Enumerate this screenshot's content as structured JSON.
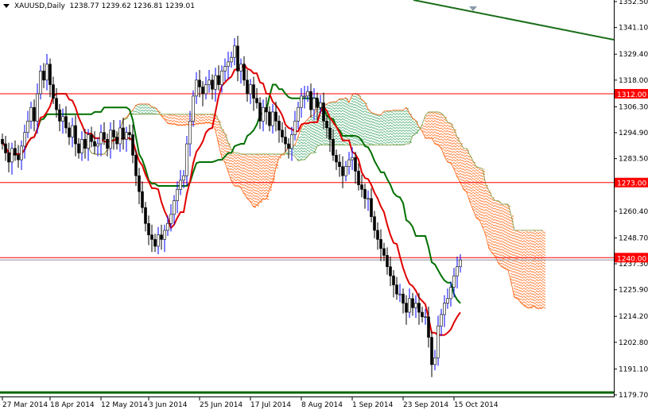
{
  "header": {
    "symbol": "XAUUSD,Daily",
    "ohlc": "1238.77 1239.62 1236.81 1239.01"
  },
  "chart_data": {
    "type": "candlestick",
    "title": "XAUUSD,Daily",
    "ylim": [
      1179.7,
      1352.5
    ],
    "y_ticks": [
      "1352.50",
      "1341.10",
      "1329.40",
      "1318.00",
      "1306.30",
      "1294.90",
      "1283.50",
      "1260.40",
      "1248.70",
      "1237.30",
      "1225.90",
      "1214.20",
      "1202.80",
      "1191.10",
      "1179.70"
    ],
    "x_ticks": [
      {
        "bar": 0,
        "label": "27 Mar 2014"
      },
      {
        "bar": 15,
        "label": "18 Apr 2014"
      },
      {
        "bar": 31,
        "label": "12 May 2014"
      },
      {
        "bar": 46,
        "label": "3 Jun 2014"
      },
      {
        "bar": 62,
        "label": "25 Jun 2014"
      },
      {
        "bar": 78,
        "label": "17 Jul 2014"
      },
      {
        "bar": 94,
        "label": "8 Aug 2014"
      },
      {
        "bar": 110,
        "label": "1 Sep 2014"
      },
      {
        "bar": 126,
        "label": "23 Sep 2014"
      },
      {
        "bar": 142,
        "label": "15 Oct 2014"
      }
    ],
    "closes": [
      1290,
      1286,
      1282,
      1288,
      1285,
      1283,
      1289,
      1295,
      1300,
      1306,
      1300,
      1312,
      1322,
      1318,
      1325,
      1316,
      1310,
      1305,
      1300,
      1302,
      1297,
      1293,
      1298,
      1290,
      1286,
      1292,
      1288,
      1294,
      1291,
      1289,
      1290,
      1295,
      1292,
      1288,
      1296,
      1293,
      1290,
      1297,
      1292,
      1295,
      1294,
      1285,
      1276,
      1269,
      1262,
      1255,
      1250,
      1248,
      1245,
      1250,
      1248,
      1252,
      1255,
      1259,
      1265,
      1270,
      1274,
      1276,
      1290,
      1300,
      1311,
      1318,
      1315,
      1312,
      1316,
      1318,
      1314,
      1320,
      1316,
      1322,
      1324,
      1326,
      1328,
      1333,
      1322,
      1325,
      1318,
      1312,
      1316,
      1310,
      1308,
      1300,
      1306,
      1304,
      1298,
      1304,
      1300,
      1296,
      1293,
      1290,
      1288,
      1294,
      1300,
      1306,
      1311,
      1311,
      1313,
      1305,
      1310,
      1306,
      1308,
      1300,
      1297,
      1292,
      1285,
      1282,
      1280,
      1276,
      1280,
      1283,
      1284,
      1278,
      1272,
      1270,
      1266,
      1266,
      1258,
      1252,
      1248,
      1244,
      1241,
      1236,
      1232,
      1228,
      1224,
      1224,
      1220,
      1216,
      1222,
      1218,
      1220,
      1216,
      1214,
      1214,
      1205,
      1193,
      1196,
      1210,
      1215,
      1220,
      1222,
      1227,
      1232,
      1236,
      1239
    ],
    "indicators": {
      "type": "Ichimoku",
      "tenkan": 9,
      "kijun": 26,
      "senkou": 52
    },
    "levels": [
      {
        "value": 1312.0,
        "label": "1312.00"
      },
      {
        "value": 1273.0,
        "label": "1273.00"
      },
      {
        "value": 1240.0,
        "label": "1240.00"
      }
    ],
    "current_price": 1239.01,
    "colors": {
      "level": "#ff0000",
      "tenkan": "#e00000",
      "kijun": "#007000",
      "cloud_bull": "#2e9e5a",
      "cloud_bear": "#ff5a00",
      "trend": "#1a6e1a",
      "wick": "#0000ff"
    }
  }
}
